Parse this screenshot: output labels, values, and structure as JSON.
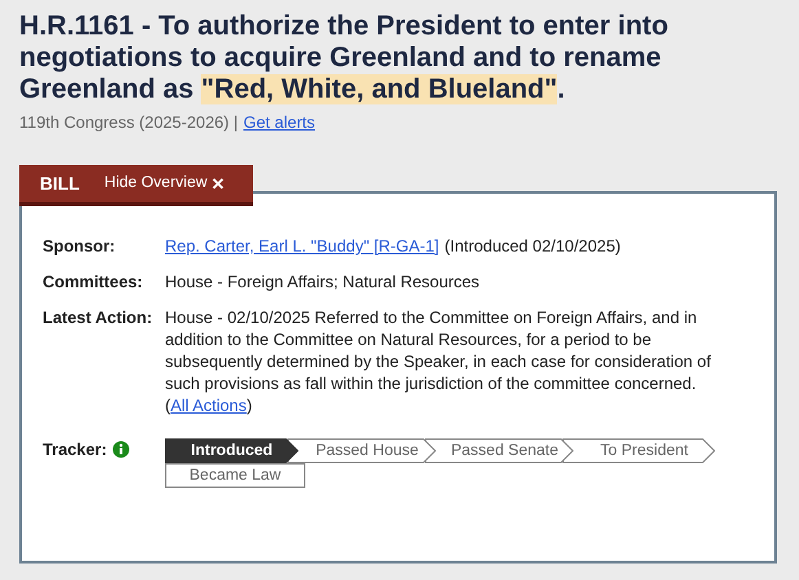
{
  "title": [
    {
      "text": "H.R.1161 - To authorize the President to enter into negotiations to acquire Greenland and to rename Greenland as ",
      "highlighted": false
    },
    {
      "text": "\"Red, White, and Blueland\"",
      "highlighted": true
    },
    {
      "text": ".",
      "highlighted": false
    }
  ],
  "congress": "119th Congress (2025-2026) |",
  "alerts_link": "Get alerts",
  "tabs": [
    {
      "label": "BILL",
      "kind": "tab"
    },
    {
      "label": "Hide Overview",
      "kind": "toggle",
      "close_icon": "✕"
    }
  ],
  "overview": {
    "sponsor": {
      "label": "Sponsor:",
      "link": "Rep. Carter, Earl L. \"Buddy\" [R-GA-1]",
      "note": "(Introduced 02/10/2025)"
    },
    "committees": {
      "label": "Committees:",
      "value": "House - Foreign Affairs; Natural Resources"
    },
    "latest_action": {
      "label": "Latest Action:",
      "text": "House - 02/10/2025 Referred to the Committee on Foreign Affairs, and in addition to the Committee on Natural Resources, for a period to be subsequently determined by the Speaker, in each case for consideration of such provisions as fall within the jurisdiction of the committee concerned.  (",
      "link": "All Actions",
      "after": ")"
    },
    "tracker": {
      "label": "Tracker:",
      "stages": [
        {
          "label": "Introduced",
          "selected": true,
          "kind": "arrow"
        },
        {
          "label": "Passed House",
          "selected": false,
          "kind": "arrow"
        },
        {
          "label": "Passed Senate",
          "selected": false,
          "kind": "arrow"
        },
        {
          "label": "To President",
          "selected": false,
          "kind": "arrow"
        },
        {
          "label": "Became Law",
          "selected": false,
          "kind": "box"
        }
      ]
    }
  }
}
